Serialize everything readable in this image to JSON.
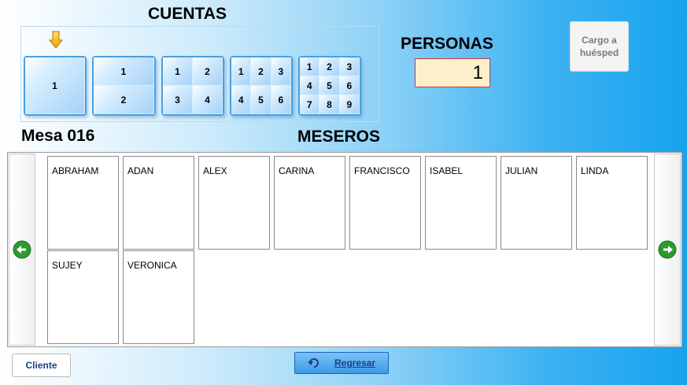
{
  "cuentas_title": "CUENTAS",
  "personas_title": "PERSONAS",
  "personas_value": "1",
  "cargo_label": "Cargo a\nhuésped",
  "mesa_label": "Mesa 016",
  "meseros_title": "MESEROS",
  "splits": [
    {
      "cells": [
        "1"
      ]
    },
    {
      "cells": [
        "1",
        "2"
      ]
    },
    {
      "cells": [
        "1",
        "2",
        "3",
        "4"
      ]
    },
    {
      "cells": [
        "1",
        "2",
        "3",
        "4",
        "5",
        "6"
      ]
    },
    {
      "cells": [
        "1",
        "2",
        "3",
        "4",
        "5",
        "6",
        "7",
        "8",
        "9"
      ]
    }
  ],
  "waiters": [
    "ABRAHAM",
    "ADAN",
    "ALEX",
    "CARINA",
    "FRANCISCO",
    "ISABEL",
    "JULIAN",
    "LINDA",
    "SUJEY",
    "VERONICA"
  ],
  "cliente_label": "Cliente",
  "regresar_label": "Regresar",
  "colors": {
    "accent": "#17a3ef",
    "personas_bg": "#fdefc9",
    "personas_border": "#c43a3a",
    "nav_arrow": "#2e9a2e"
  },
  "icons": {
    "selector": "down-arrow-icon",
    "prev": "left-arrow-icon",
    "next": "right-arrow-icon",
    "regresar": "undo-icon"
  }
}
